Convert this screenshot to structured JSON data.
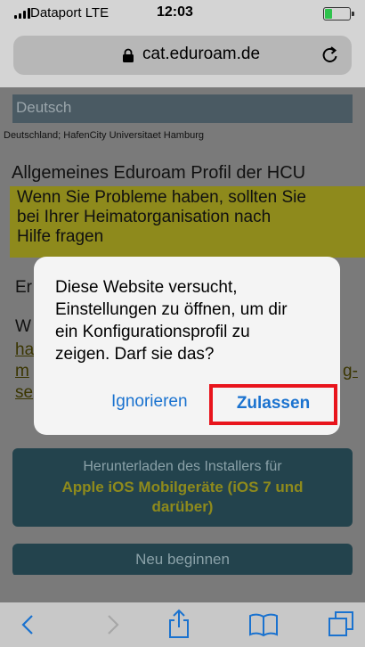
{
  "status_bar": {
    "carrier": "Dataport  LTE",
    "time": "12:03",
    "battery_level": 0.3,
    "battery_color": "#2fc24d"
  },
  "browser": {
    "url": "cat.eduroam.de",
    "lock_icon": "lock-icon",
    "reload_icon": "reload-icon"
  },
  "page": {
    "language_selector": "Deutsch",
    "location": "Deutschland; HafenCity Universitaet Hamburg",
    "profile_title": "Allgemeines Eduroam Profil der HCU",
    "help_notice_lines": [
      "Wenn Sie Probleme haben, sollten Sie",
      "bei Ihrer Heimatorganisation nach",
      "Hilfe fragen"
    ],
    "partial_text_1": "Er",
    "partial_text_2": "W",
    "partial_link_1": "ha",
    "partial_link_2": "m",
    "partial_link_3": "g-",
    "partial_link_4": "se",
    "install_button": {
      "line1": "Herunterladen des Installers für",
      "line2": "Apple iOS Mobilgeräte (iOS 7 und",
      "line3": "darüber)"
    },
    "restart_button": "Neu beginnen"
  },
  "dialog": {
    "message_lines": [
      "Diese Website versucht,",
      "Einstellungen zu öffnen, um dir",
      "ein Konfigurationsprofil zu",
      "zeigen. Darf sie das?"
    ],
    "ignore_label": "Ignorieren",
    "allow_label": "Zulassen",
    "highlight_color": "#e8141c"
  },
  "toolbar": {
    "icons": [
      "back-icon",
      "forward-icon",
      "share-icon",
      "bookmarks-icon",
      "tabs-icon"
    ],
    "accent_color": "#1a72cf"
  }
}
